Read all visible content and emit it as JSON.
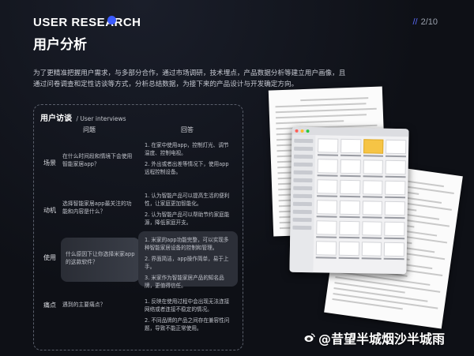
{
  "header": {
    "brand": "USER RESEARCH",
    "title": "用户分析",
    "page": "2/10"
  },
  "intro": "为了更精准把握用户需求，与多部分合作，通过市场调研，技术埋点，产品数据分析等建立用户画像，且通过问卷调查和定性访谈等方式，分析总结数据，为接下来的产品设计与开发确定方向。",
  "interviews": {
    "heading": "用户访谈",
    "heading_en": "/ User interviews",
    "col_question": "问题",
    "col_answer": "回答",
    "rows": [
      {
        "label": "场景",
        "question": "在什么时间段和情境下会使用智能家居app？",
        "answers": [
          "1. 在家中使用app，控制灯光、调节温度、控制电视。",
          "2. 外出或者出差等情况下，使用app远程控制设备。"
        ]
      },
      {
        "label": "动机",
        "question": "选择智能家居app最关注的功能和内容是什么？",
        "answers": [
          "1. 认为智能产品可以提高生活的便利性，让家庭更加智能化。",
          "2. 认为智能产品可以帮助节约家庭能源，降低家庭开支。"
        ]
      },
      {
        "label": "使用",
        "question": "什么原因下让你选择米家app的这款软件？",
        "answers": [
          "1. 米家的app功能完整，可以实现多种智能家居设备的控制和管理。",
          "2. 界面简洁，app操作简单，易于上手。",
          "3. 米家作为智能家居产品的知名品牌，更值得信任。"
        ]
      },
      {
        "label": "痛点",
        "question": "遇到的主要痛点？",
        "answers": [
          "1. 反映在使用过程中会出现无法连接网络或者连接不稳定的情况。",
          "2. 不同品牌的产品之间存在兼容性问题，导致不能正常使用。"
        ]
      }
    ]
  },
  "watermark": "@昔望半城烟沙半城雨",
  "colors": {
    "background": "#0e1016",
    "accent": "#3b5bff",
    "highlight": "#2c2f38"
  }
}
